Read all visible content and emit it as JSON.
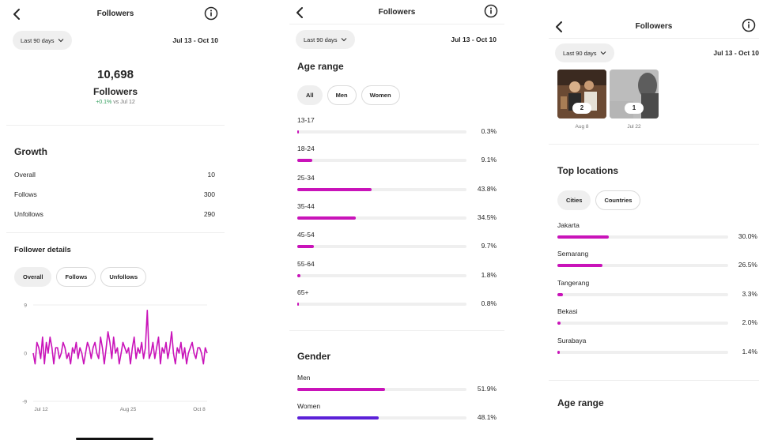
{
  "colors": {
    "accent": "#c913b9",
    "men_bar": "#c913b9",
    "women_bar": "#5b21d8",
    "track": "#efefef",
    "change_positive": "#2e9c5a"
  },
  "icons": {
    "back": "chevron-left-icon",
    "info": "info-icon",
    "dropdown": "chevron-down-icon"
  },
  "panel1": {
    "header_title": "Followers",
    "filter_label": "Last 90 days",
    "date_range": "Jul 13 - Oct 10",
    "total_count": "10,698",
    "total_label": "Followers",
    "change_text": "+0.1%",
    "change_suffix": "vs Jul 12",
    "growth_title": "Growth",
    "growth_rows": [
      {
        "label": "Overall",
        "value": "10"
      },
      {
        "label": "Follows",
        "value": "300"
      },
      {
        "label": "Unfollows",
        "value": "290"
      }
    ],
    "details_title": "Follower details",
    "details_tabs": [
      "Overall",
      "Follows",
      "Unfollows"
    ],
    "chart_data": {
      "type": "line",
      "title": "",
      "xlabel": "",
      "ylabel": "",
      "ylim": [
        -9,
        9
      ],
      "y_ticks": [
        "9",
        "0",
        "-9"
      ],
      "x_ticks": [
        "Jul 12",
        "Aug 25",
        "Oct 8"
      ],
      "grid": true,
      "series": [
        {
          "values": [
            0,
            -2,
            2,
            1,
            -1,
            3,
            -2,
            2,
            0,
            3,
            1,
            -2,
            1,
            1,
            -1,
            0,
            2,
            1,
            -1,
            0,
            -2,
            1,
            0,
            2,
            -1,
            1,
            0,
            -2,
            0,
            2,
            1,
            -1,
            1,
            2,
            0,
            -1,
            3,
            1,
            -2,
            1,
            4,
            2,
            -1,
            3,
            0,
            1,
            -2,
            0,
            2,
            1,
            0,
            1,
            -2,
            1,
            3,
            -1,
            1,
            0,
            2,
            -1,
            1,
            8,
            -1,
            0,
            2,
            -1,
            1,
            3,
            -2,
            1,
            0,
            2,
            -1,
            1,
            4,
            0,
            -2,
            1,
            0,
            2,
            -1,
            1,
            -2,
            0,
            1,
            2,
            0,
            -1,
            1,
            1,
            0,
            -2,
            1,
            0
          ]
        }
      ]
    }
  },
  "panel2": {
    "header_title": "Followers",
    "filter_label": "Last 90 days",
    "date_range": "Jul 13 - Oct 10",
    "age_title": "Age range",
    "age_tabs": [
      "All",
      "Men",
      "Women"
    ],
    "age_rows": [
      {
        "label": "13-17",
        "pct": "0.3%",
        "value": 0.3
      },
      {
        "label": "18-24",
        "pct": "9.1%",
        "value": 9.1
      },
      {
        "label": "25-34",
        "pct": "43.8%",
        "value": 43.8
      },
      {
        "label": "35-44",
        "pct": "34.5%",
        "value": 34.5
      },
      {
        "label": "45-54",
        "pct": "9.7%",
        "value": 9.7
      },
      {
        "label": "55-64",
        "pct": "1.8%",
        "value": 1.8
      },
      {
        "label": "65+",
        "pct": "0.8%",
        "value": 0.8
      }
    ],
    "gender_title": "Gender",
    "gender_rows": [
      {
        "label": "Men",
        "pct": "51.9%",
        "value": 51.9
      },
      {
        "label": "Women",
        "pct": "48.1%",
        "value": 48.1
      }
    ]
  },
  "panel3": {
    "header_title": "Followers",
    "filter_label": "Last 90 days",
    "date_range": "Jul 13 - Oct 10",
    "thumbs": [
      {
        "count": "2",
        "date": "Aug 8"
      },
      {
        "count": "1",
        "date": "Jul 22"
      }
    ],
    "locations_title": "Top locations",
    "locations_tabs": [
      "Cities",
      "Countries"
    ],
    "location_rows": [
      {
        "label": "Jakarta",
        "pct": "30.0%",
        "value": 30.0
      },
      {
        "label": "Semarang",
        "pct": "26.5%",
        "value": 26.5
      },
      {
        "label": "Tangerang",
        "pct": "3.3%",
        "value": 3.3
      },
      {
        "label": "Bekasi",
        "pct": "2.0%",
        "value": 2.0
      },
      {
        "label": "Surabaya",
        "pct": "1.4%",
        "value": 1.4
      }
    ],
    "age_title": "Age range"
  }
}
